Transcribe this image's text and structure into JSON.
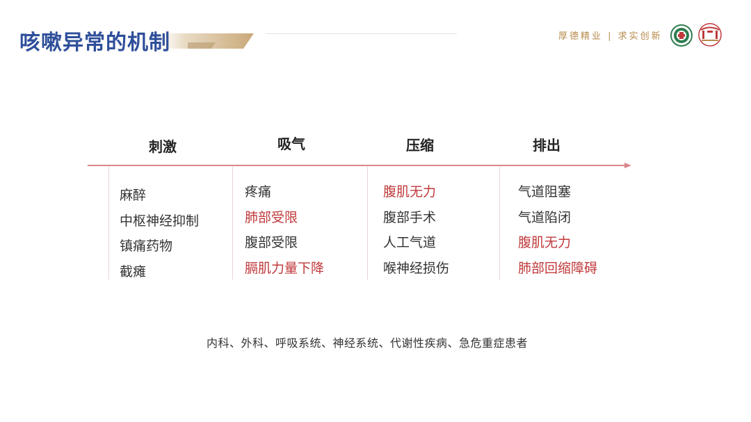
{
  "header": {
    "title": "咳嗽异常的机制",
    "motto": "厚德精业 | 求实创新",
    "logos": [
      "emblem-icon",
      "campus-gate-icon"
    ]
  },
  "stages": [
    {
      "label": "刺激",
      "items": [
        {
          "text": "麻醉",
          "highlight": false
        },
        {
          "text": "中枢神经抑制",
          "highlight": false
        },
        {
          "text": "镇痛药物",
          "highlight": false
        },
        {
          "text": "截瘫",
          "highlight": false
        }
      ]
    },
    {
      "label": "吸气",
      "items": [
        {
          "text": "疼痛",
          "highlight": false
        },
        {
          "text": "肺部受限",
          "highlight": true
        },
        {
          "text": "腹部受限",
          "highlight": false
        },
        {
          "text": "膈肌力量下降",
          "highlight": true
        }
      ]
    },
    {
      "label": "压缩",
      "items": [
        {
          "text": "腹肌无力",
          "highlight": true
        },
        {
          "text": "腹部手术",
          "highlight": false
        },
        {
          "text": "人工气道",
          "highlight": false
        },
        {
          "text": "喉神经损伤",
          "highlight": false
        }
      ]
    },
    {
      "label": "排出",
      "items": [
        {
          "text": "气道阻塞",
          "highlight": false
        },
        {
          "text": "气道陷闭",
          "highlight": false
        },
        {
          "text": "腹肌无力",
          "highlight": true
        },
        {
          "text": "肺部回缩障碍",
          "highlight": true
        }
      ]
    }
  ],
  "footer": "内科、外科、呼吸系统、神经系统、代谢性疾病、急危重症患者",
  "colors": {
    "title": "#2f4f9a",
    "accent_gold": "#b78a4b",
    "highlight": "#c0393b",
    "arrow": "#d9868a",
    "divider": "#ead4d4"
  }
}
